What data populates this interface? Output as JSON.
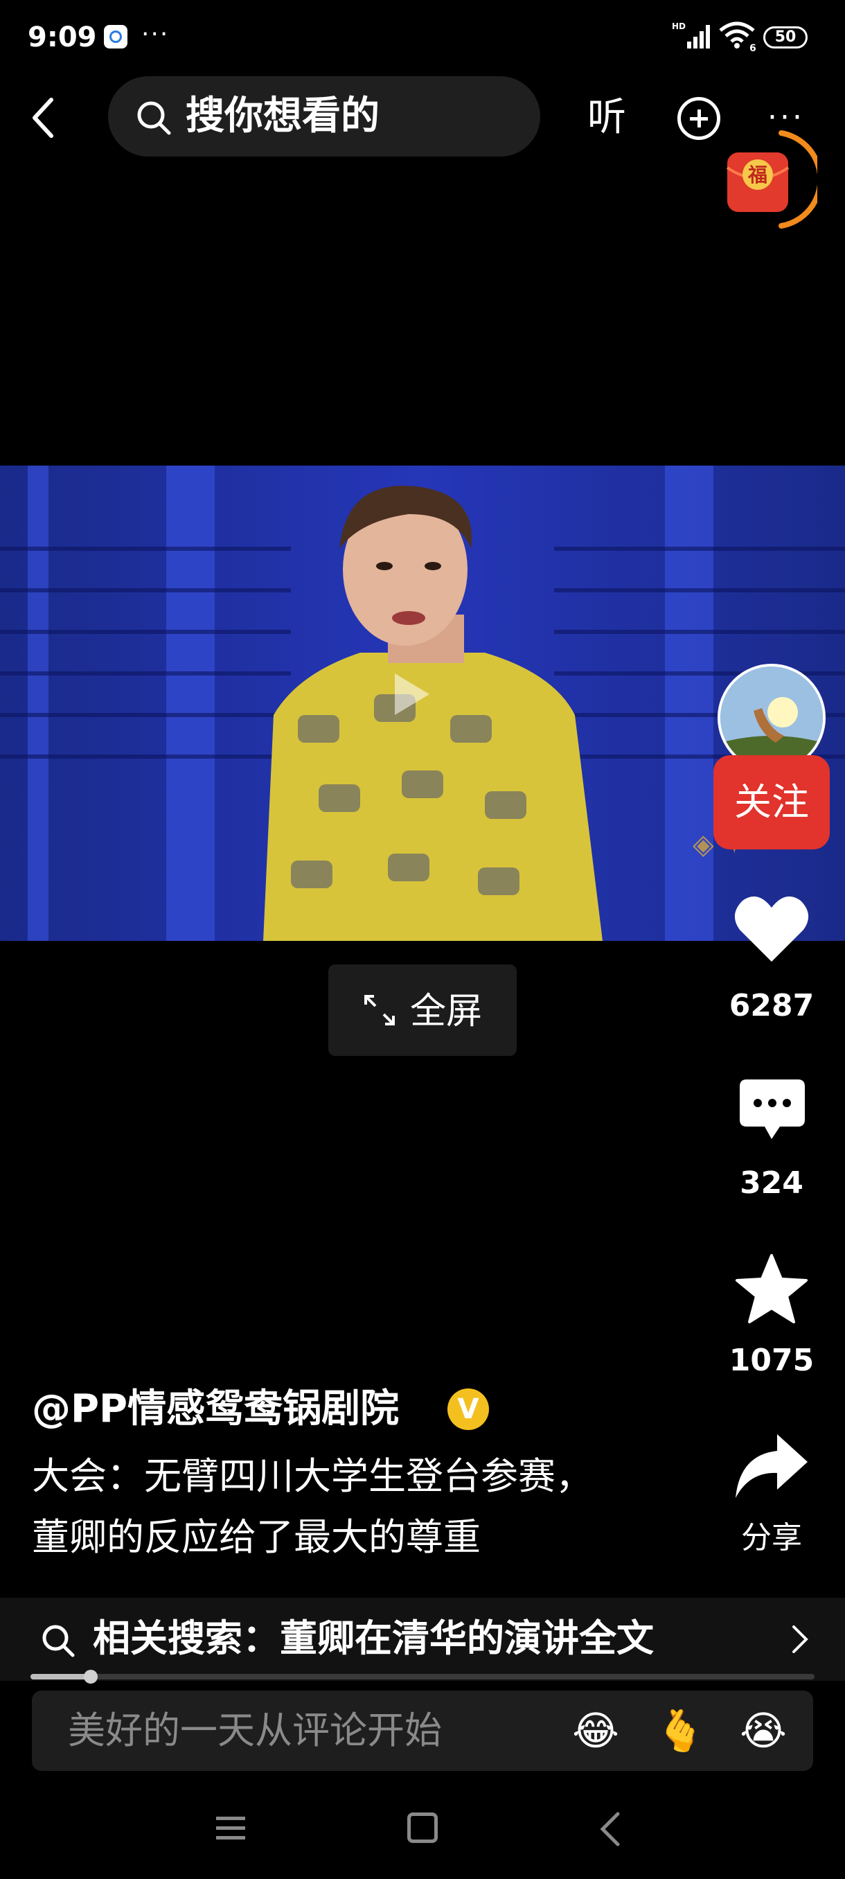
{
  "status_bar": {
    "time": "9:09",
    "dots": "···",
    "battery": "50"
  },
  "top_bar": {
    "search_placeholder": "搜你想看的",
    "listen_label": "听",
    "more_label": "···",
    "red_packet_label": "福"
  },
  "video": {
    "fullscreen_label": "全屏"
  },
  "actions": {
    "follow_label": "关注",
    "like_count": "6287",
    "comment_count": "324",
    "favorite_count": "1075",
    "share_label": "分享"
  },
  "post": {
    "author": "@PP情感鸳鸯锅剧院",
    "verified_mark": "V",
    "caption_line_1": "大会：无臂四川大学生登台参赛，",
    "caption_line_2": "董卿的反应给了最大的尊重"
  },
  "related_search": {
    "text": "相关搜索：董卿在清华的演讲全文"
  },
  "playback": {
    "progress": 0.077
  },
  "comment_bar": {
    "placeholder": "美好的一天从评论开始",
    "emojis": [
      "😂",
      "🫰",
      "😭"
    ]
  },
  "colors": {
    "follow_red": "#e2332d",
    "verified_gold": "#f4c020",
    "red_packet_orange": "#f28a1c"
  }
}
